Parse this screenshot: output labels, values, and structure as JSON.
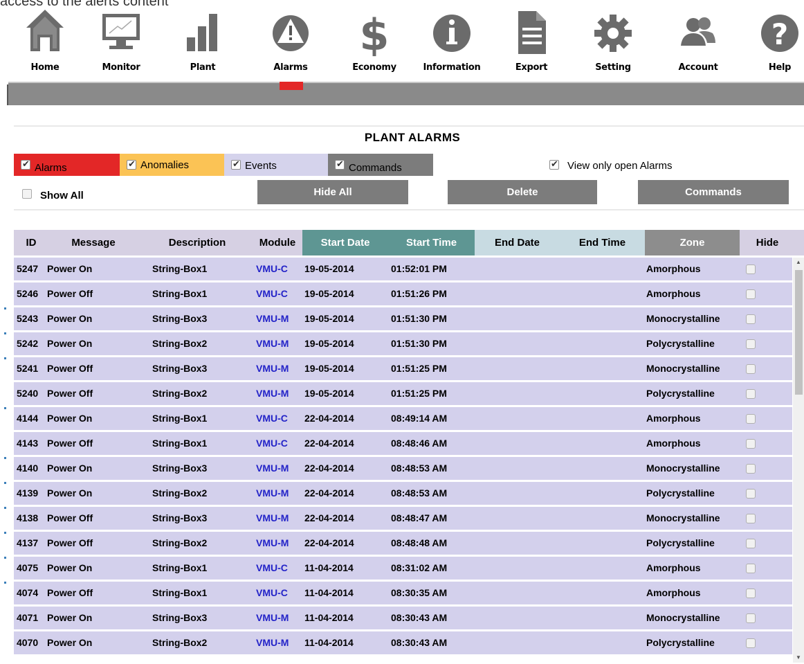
{
  "top_cut_text": "access to the alerts content",
  "nav": [
    {
      "label": "Home",
      "icon": "home-icon"
    },
    {
      "label": "Monitor",
      "icon": "monitor-icon"
    },
    {
      "label": "Plant",
      "icon": "plant-icon"
    },
    {
      "label": "Alarms",
      "icon": "alarm-warning-icon"
    },
    {
      "label": "Economy",
      "icon": "dollar-icon"
    },
    {
      "label": "Information",
      "icon": "info-icon"
    },
    {
      "label": "Export",
      "icon": "document-icon"
    },
    {
      "label": "Setting",
      "icon": "gear-icon"
    },
    {
      "label": "Account",
      "icon": "users-icon"
    },
    {
      "label": "Help",
      "icon": "help-icon"
    }
  ],
  "page_title": "PLANT ALARMS",
  "filters": [
    {
      "label": "Alarms",
      "checked": true,
      "color": "#e32727"
    },
    {
      "label": "Anomalies",
      "checked": true,
      "color": "#fbc355"
    },
    {
      "label": "Events",
      "checked": true,
      "color": "#d5d3ec"
    },
    {
      "label": "Commands",
      "checked": true,
      "color": "#7c7c7c"
    }
  ],
  "view_only_open": {
    "label": "View only open Alarms",
    "checked": true
  },
  "show_all": {
    "label": "Show All",
    "checked": false
  },
  "buttons": {
    "hide_all": "Hide All",
    "delete": "Delete",
    "commands": "Commands"
  },
  "columns": [
    "ID",
    "Message",
    "Description",
    "Module",
    "Start Date",
    "Start Time",
    "End Date",
    "End Time",
    "Zone",
    "Hide"
  ],
  "rows": [
    {
      "id": "5247",
      "message": "Power On",
      "description": "String-Box1",
      "module": "VMU-C",
      "start_date": "19-05-2014",
      "start_time": "01:52:01 PM",
      "end_date": "",
      "end_time": "",
      "zone": "Amorphous"
    },
    {
      "id": "5246",
      "message": "Power Off",
      "description": "String-Box1",
      "module": "VMU-C",
      "start_date": "19-05-2014",
      "start_time": "01:51:26 PM",
      "end_date": "",
      "end_time": "",
      "zone": "Amorphous"
    },
    {
      "id": "5243",
      "message": "Power On",
      "description": "String-Box3",
      "module": "VMU-M",
      "start_date": "19-05-2014",
      "start_time": "01:51:30 PM",
      "end_date": "",
      "end_time": "",
      "zone": "Monocrystalline"
    },
    {
      "id": "5242",
      "message": "Power On",
      "description": "String-Box2",
      "module": "VMU-M",
      "start_date": "19-05-2014",
      "start_time": "01:51:30 PM",
      "end_date": "",
      "end_time": "",
      "zone": "Polycrystalline"
    },
    {
      "id": "5241",
      "message": "Power Off",
      "description": "String-Box3",
      "module": "VMU-M",
      "start_date": "19-05-2014",
      "start_time": "01:51:25 PM",
      "end_date": "",
      "end_time": "",
      "zone": "Monocrystalline"
    },
    {
      "id": "5240",
      "message": "Power Off",
      "description": "String-Box2",
      "module": "VMU-M",
      "start_date": "19-05-2014",
      "start_time": "01:51:25 PM",
      "end_date": "",
      "end_time": "",
      "zone": "Polycrystalline"
    },
    {
      "id": "4144",
      "message": "Power On",
      "description": "String-Box1",
      "module": "VMU-C",
      "start_date": "22-04-2014",
      "start_time": "08:49:14 AM",
      "end_date": "",
      "end_time": "",
      "zone": "Amorphous"
    },
    {
      "id": "4143",
      "message": "Power Off",
      "description": "String-Box1",
      "module": "VMU-C",
      "start_date": "22-04-2014",
      "start_time": "08:48:46 AM",
      "end_date": "",
      "end_time": "",
      "zone": "Amorphous"
    },
    {
      "id": "4140",
      "message": "Power On",
      "description": "String-Box3",
      "module": "VMU-M",
      "start_date": "22-04-2014",
      "start_time": "08:48:53 AM",
      "end_date": "",
      "end_time": "",
      "zone": "Monocrystalline"
    },
    {
      "id": "4139",
      "message": "Power On",
      "description": "String-Box2",
      "module": "VMU-M",
      "start_date": "22-04-2014",
      "start_time": "08:48:53 AM",
      "end_date": "",
      "end_time": "",
      "zone": "Polycrystalline"
    },
    {
      "id": "4138",
      "message": "Power Off",
      "description": "String-Box3",
      "module": "VMU-M",
      "start_date": "22-04-2014",
      "start_time": "08:48:47 AM",
      "end_date": "",
      "end_time": "",
      "zone": "Monocrystalline"
    },
    {
      "id": "4137",
      "message": "Power Off",
      "description": "String-Box2",
      "module": "VMU-M",
      "start_date": "22-04-2014",
      "start_time": "08:48:48 AM",
      "end_date": "",
      "end_time": "",
      "zone": "Polycrystalline"
    },
    {
      "id": "4075",
      "message": "Power On",
      "description": "String-Box1",
      "module": "VMU-C",
      "start_date": "11-04-2014",
      "start_time": "08:31:02 AM",
      "end_date": "",
      "end_time": "",
      "zone": "Amorphous"
    },
    {
      "id": "4074",
      "message": "Power Off",
      "description": "String-Box1",
      "module": "VMU-C",
      "start_date": "11-04-2014",
      "start_time": "08:30:35 AM",
      "end_date": "",
      "end_time": "",
      "zone": "Amorphous"
    },
    {
      "id": "4071",
      "message": "Power On",
      "description": "String-Box3",
      "module": "VMU-M",
      "start_date": "11-04-2014",
      "start_time": "08:30:43 AM",
      "end_date": "",
      "end_time": "",
      "zone": "Monocrystalline"
    },
    {
      "id": "4070",
      "message": "Power On",
      "description": "String-Box2",
      "module": "VMU-M",
      "start_date": "11-04-2014",
      "start_time": "08:30:43 AM",
      "end_date": "",
      "end_time": "",
      "zone": "Polycrystalline"
    }
  ],
  "colors": {
    "accent_red": "#e32727",
    "header_teal": "#5e9693",
    "header_light_blue": "#c8dbe2",
    "header_gray": "#8d8d8d",
    "row_bg": "#d3d0ec",
    "module_blue": "#2323c8",
    "button_gray": "#7c7c7c"
  }
}
